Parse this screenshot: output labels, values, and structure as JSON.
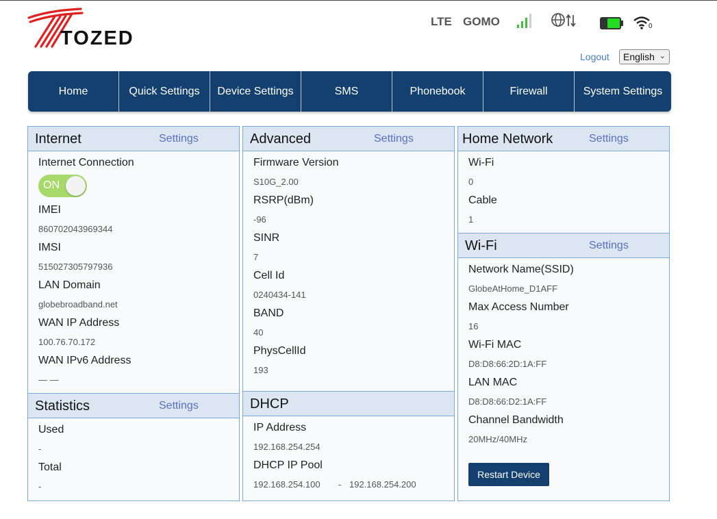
{
  "brand": {
    "name": "TOZED",
    "logo_color": "#e0201f"
  },
  "status": {
    "network_type": "LTE",
    "operator": "GOMO",
    "signal_icon": "signal-bars-icon",
    "data_icon": "globe-updown-icon",
    "battery_color": "#22dd22",
    "wifi_clients": "0"
  },
  "header": {
    "logout": "Logout",
    "language": "English"
  },
  "nav": {
    "items": [
      "Home",
      "Quick Settings",
      "Device Settings",
      "SMS",
      "Phonebook",
      "Firewall",
      "System Settings"
    ]
  },
  "internet": {
    "title": "Internet",
    "settings": "Settings",
    "connection_label": "Internet Connection",
    "connection_toggle": "ON",
    "imei_label": "IMEI",
    "imei": "860702043969344",
    "imsi_label": "IMSI",
    "imsi": "515027305797936",
    "lan_domain_label": "LAN Domain",
    "lan_domain": "globebroadband.net",
    "wan_ip_label": "WAN IP Address",
    "wan_ip": "100.76.70.172",
    "wan_ipv6_label": "WAN IPv6 Address",
    "wan_ipv6": "— —"
  },
  "statistics": {
    "title": "Statistics",
    "settings": "Settings",
    "used_label": "Used",
    "used": "-",
    "total_label": "Total",
    "total": "-"
  },
  "advanced": {
    "title": "Advanced",
    "settings": "Settings",
    "fw_label": "Firmware Version",
    "fw": "S10G_2.00",
    "rsrp_label": "RSRP(dBm)",
    "rsrp": "-96",
    "sinr_label": "SINR",
    "sinr": "7",
    "cell_label": "Cell Id",
    "cell": "0240434-141",
    "band_label": "BAND",
    "band": "40",
    "pci_label": "PhysCellId",
    "pci": "193"
  },
  "dhcp": {
    "title": "DHCP",
    "ip_label": "IP Address",
    "ip": "192.168.254.254",
    "pool_label": "DHCP IP Pool",
    "pool_start": "192.168.254.100",
    "pool_sep": "-",
    "pool_end": "192.168.254.200"
  },
  "home_network": {
    "title": "Home Network",
    "settings": "Settings",
    "wifi_label": "Wi-Fi",
    "wifi": "0",
    "cable_label": "Cable",
    "cable": "1"
  },
  "wifi": {
    "title": "Wi-Fi",
    "settings": "Settings",
    "ssid_label": "Network Name(SSID)",
    "ssid": "GlobeAtHome_D1AFF",
    "max_label": "Max Access Number",
    "max": "16",
    "wifimac_label": "Wi-Fi MAC",
    "wifimac": "D8:D8:66:2D:1A:FF",
    "lanmac_label": "LAN MAC",
    "lanmac": "D8:D8:66:D2:1A:FF",
    "bw_label": "Channel Bandwidth",
    "bw": "20MHz/40MHz",
    "restart": "Restart Device"
  }
}
